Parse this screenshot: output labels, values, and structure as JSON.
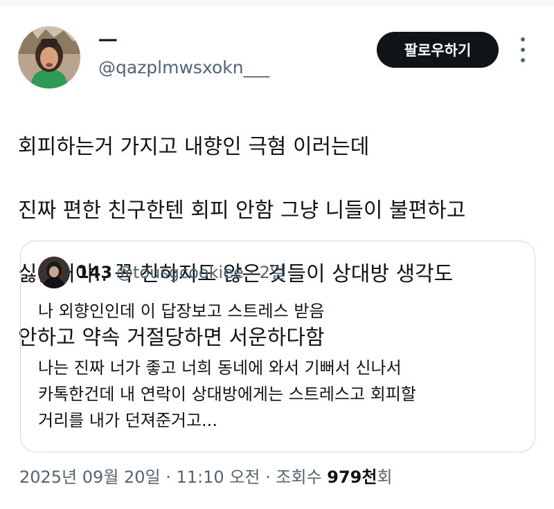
{
  "tweet": {
    "author": {
      "display_name": "ㅡ",
      "handle": "@qazplmwsxokn___"
    },
    "follow_label": "팔로우하기",
    "more_icon": "more-vertical-icon",
    "text_lines": [
      "회피하는거 가지고 내향인 극혐 이러는데",
      "진짜 편한 친구한텐 회피 안함 그냥 니들이 불편하고",
      "싫은거야.. 꼭 친하지도 않은 것들이 상대방 생각도",
      "안하고 약속 거절당하면 서운하다함"
    ],
    "quote": {
      "display_name": "143",
      "meta": "@tousgcookiee · 2일",
      "para1": "나 외향인인데 이 답장보고 스트레스 받음",
      "para2_lines": [
        "나는 진짜 너가 좋고 너희 동네에 와서 기뻐서 신나서",
        "카톡한건데 내 연락이 상대방에게는 스트레스고 회피할",
        "거리를 내가 던져준거고..."
      ]
    },
    "footer": {
      "datetime": "2025년 09월 20일 · 11:10 오전 · 조회수 ",
      "views_count": "979천",
      "views_suffix": "회"
    }
  },
  "colors": {
    "text_primary": "#0f1419",
    "text_secondary": "#536471",
    "button_bg": "#0f1419",
    "border": "#cfd9de"
  }
}
